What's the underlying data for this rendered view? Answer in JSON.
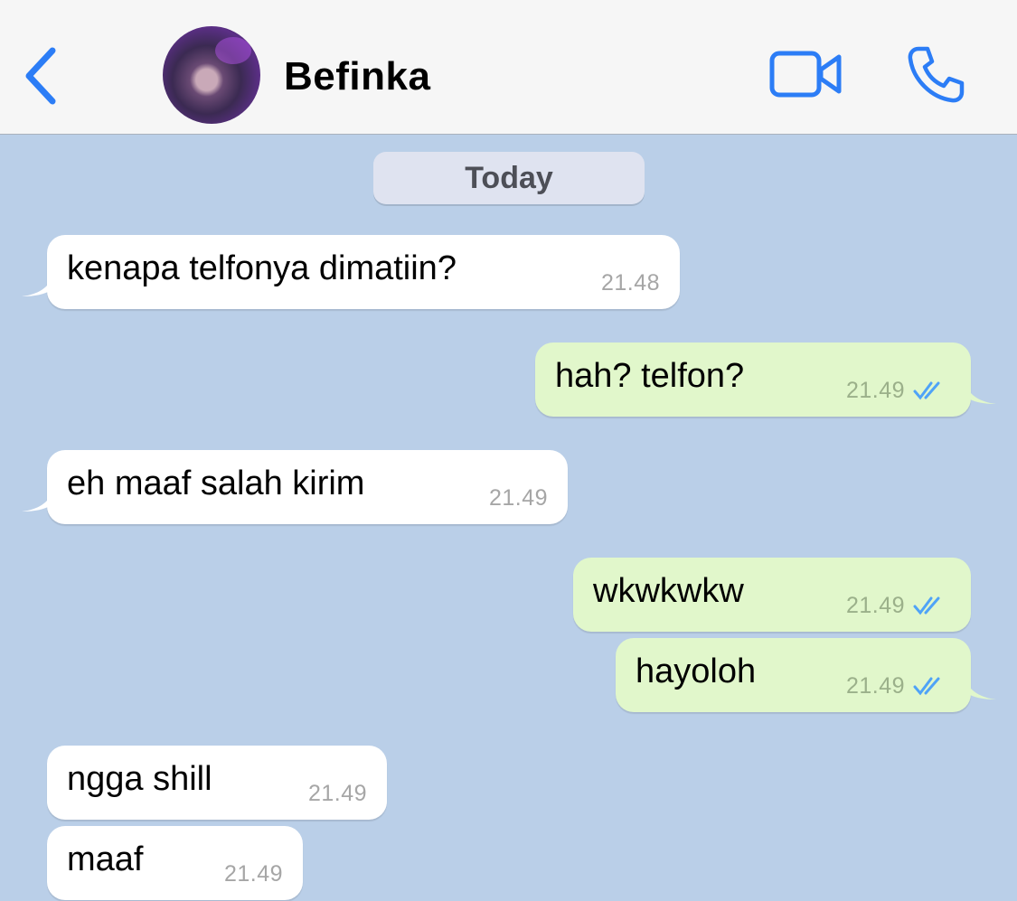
{
  "header": {
    "contact_name": "Befinka",
    "icons": [
      "chevron-left-icon",
      "avatar",
      "video-camera-icon",
      "phone-icon"
    ],
    "accent_color": "#2c7df6"
  },
  "date_separator": "Today",
  "messages": [
    {
      "direction": "incoming",
      "text": "kenapa telfonya dimatiin?",
      "time": "21.48"
    },
    {
      "direction": "outgoing",
      "text": "hah? telfon?",
      "time": "21.49",
      "status": "read"
    },
    {
      "direction": "incoming",
      "text": "eh maaf salah kirim",
      "time": "21.49"
    },
    {
      "direction": "outgoing",
      "text": "wkwkwkw",
      "time": "21.49",
      "status": "read"
    },
    {
      "direction": "outgoing",
      "text": "hayoloh",
      "time": "21.49",
      "status": "read"
    },
    {
      "direction": "incoming",
      "text": "ngga shill",
      "time": "21.49"
    },
    {
      "direction": "incoming",
      "text": "maaf",
      "time": "21.49"
    }
  ],
  "colors": {
    "chat_background": "#bacfe8",
    "incoming_bubble": "#ffffff",
    "outgoing_bubble": "#e1f7cb",
    "read_tick": "#4fa3f7"
  }
}
